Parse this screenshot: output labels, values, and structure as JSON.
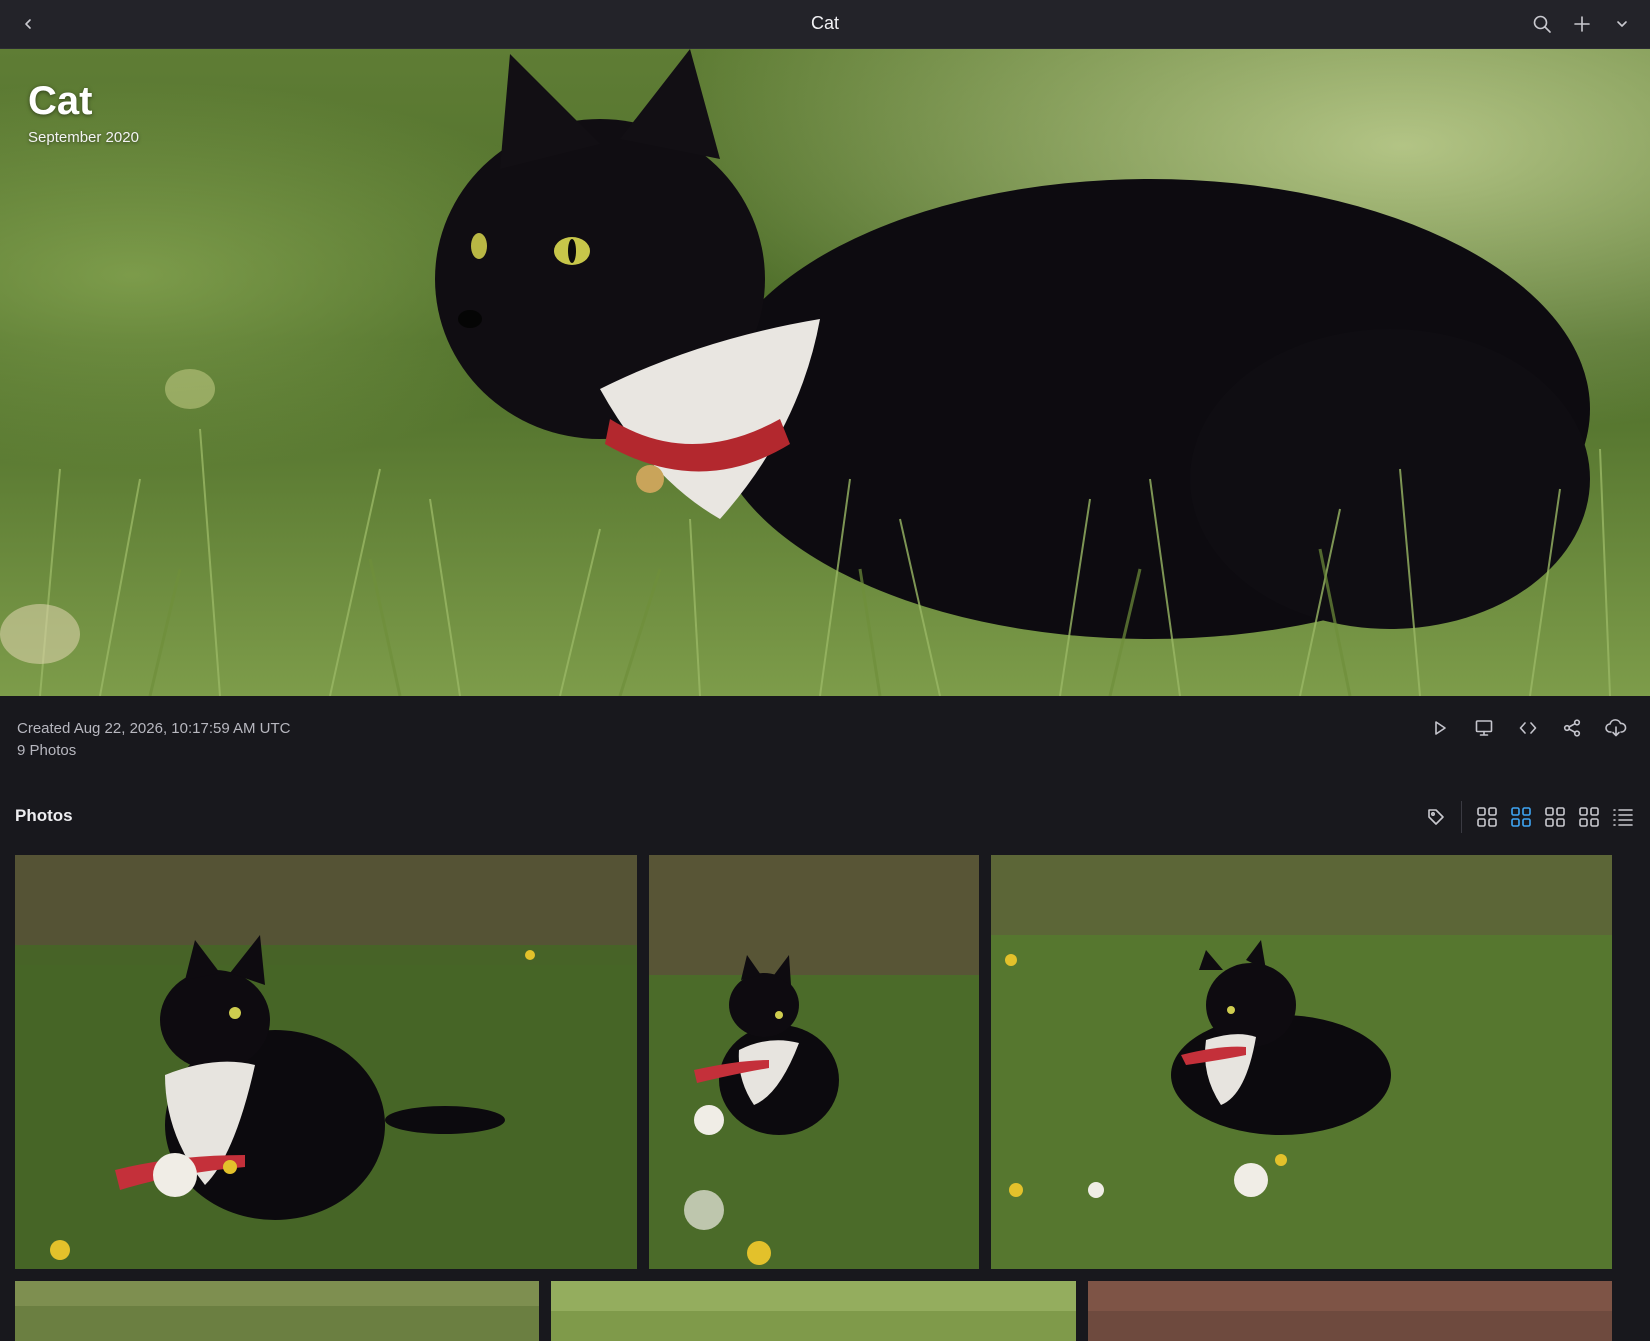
{
  "topbar": {
    "title": "Cat",
    "icons": [
      "chevron-left-icon",
      "search-icon",
      "plus-icon",
      "chevron-down-icon"
    ]
  },
  "hero": {
    "title": "Cat",
    "subtitle": "September 2020"
  },
  "meta": {
    "created": "Created Aug 22, 2026, 10:17:59 AM UTC",
    "count": "9 Photos",
    "actions": [
      "play-icon",
      "monitor-icon",
      "code-icon",
      "share-icon",
      "cloud-download-icon"
    ]
  },
  "photos_section": {
    "heading": "Photos",
    "view_modes": [
      "grid-small-icon",
      "grid-medium-icon",
      "grid-large-icon",
      "grid-xlarge-icon",
      "list-icon"
    ],
    "active_view": "grid-medium-icon"
  },
  "colors": {
    "background": "#18181d",
    "topbar": "#232329",
    "accent": "#3fa6f5"
  }
}
